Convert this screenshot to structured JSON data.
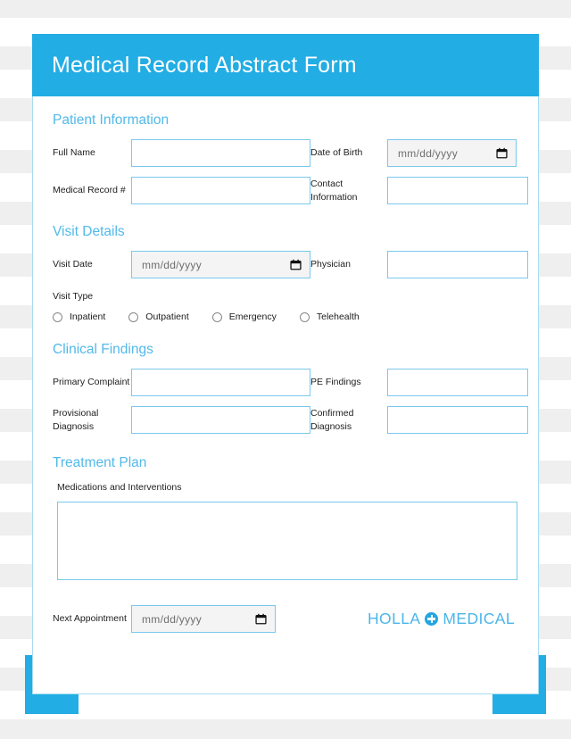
{
  "header": {
    "title": "Medical Record Abstract Form"
  },
  "sections": {
    "patient_information": {
      "heading": "Patient Information",
      "fields": {
        "full_name": {
          "label": "Full Name",
          "value": "",
          "type": "text"
        },
        "date_of_birth": {
          "label": "Date of Birth",
          "value": "",
          "placeholder": "mm/dd/yyyy",
          "type": "date"
        },
        "medical_record_number": {
          "label": "Medical Record #",
          "value": "",
          "type": "text"
        },
        "contact_information": {
          "label": "Contact Information",
          "value": "",
          "type": "text"
        }
      }
    },
    "visit_details": {
      "heading": "Visit Details",
      "fields": {
        "visit_date": {
          "label": "Visit Date",
          "value": "",
          "placeholder": "mm/dd/yyyy",
          "type": "date"
        },
        "physician": {
          "label": "Physician",
          "value": "",
          "type": "text"
        }
      },
      "visit_type": {
        "label": "Visit Type",
        "selected": null,
        "options": [
          {
            "label": "Inpatient",
            "checked": false
          },
          {
            "label": "Outpatient",
            "checked": false
          },
          {
            "label": "Emergency",
            "checked": false
          },
          {
            "label": "Telehealth",
            "checked": false
          }
        ]
      }
    },
    "clinical_findings": {
      "heading": "Clinical Findings",
      "fields": {
        "primary_complaint": {
          "label": "Primary Complaint",
          "value": "",
          "type": "text"
        },
        "pe_findings": {
          "label": "PE Findings",
          "value": "",
          "type": "text"
        },
        "provisional_diagnosis": {
          "label": "Provisional Diagnosis",
          "value": "",
          "type": "text"
        },
        "confirmed_diagnosis": {
          "label": "Confirmed Diagnosis",
          "value": "",
          "type": "text"
        }
      }
    },
    "treatment_plan": {
      "heading": "Treatment Plan",
      "medications": {
        "label": "Medications and Interventions",
        "value": "",
        "type": "textarea"
      },
      "next_appointment": {
        "label": "Next Appointment",
        "value": "",
        "placeholder": "mm/dd/yyyy",
        "type": "date"
      }
    }
  },
  "footer": {
    "brand": {
      "word_left": "HOLLA",
      "word_right": "MEDICAL",
      "mark_icon": "medical-cross-circle-icon"
    }
  },
  "colors": {
    "accent": "#22ade4",
    "heading": "#52b9e9",
    "field_border": "#79c9ec",
    "card_border": "#a8dcf2",
    "date_field_bg": "#f4f4f4",
    "grid_line": "#efefef",
    "text": "#1d1d1d"
  }
}
